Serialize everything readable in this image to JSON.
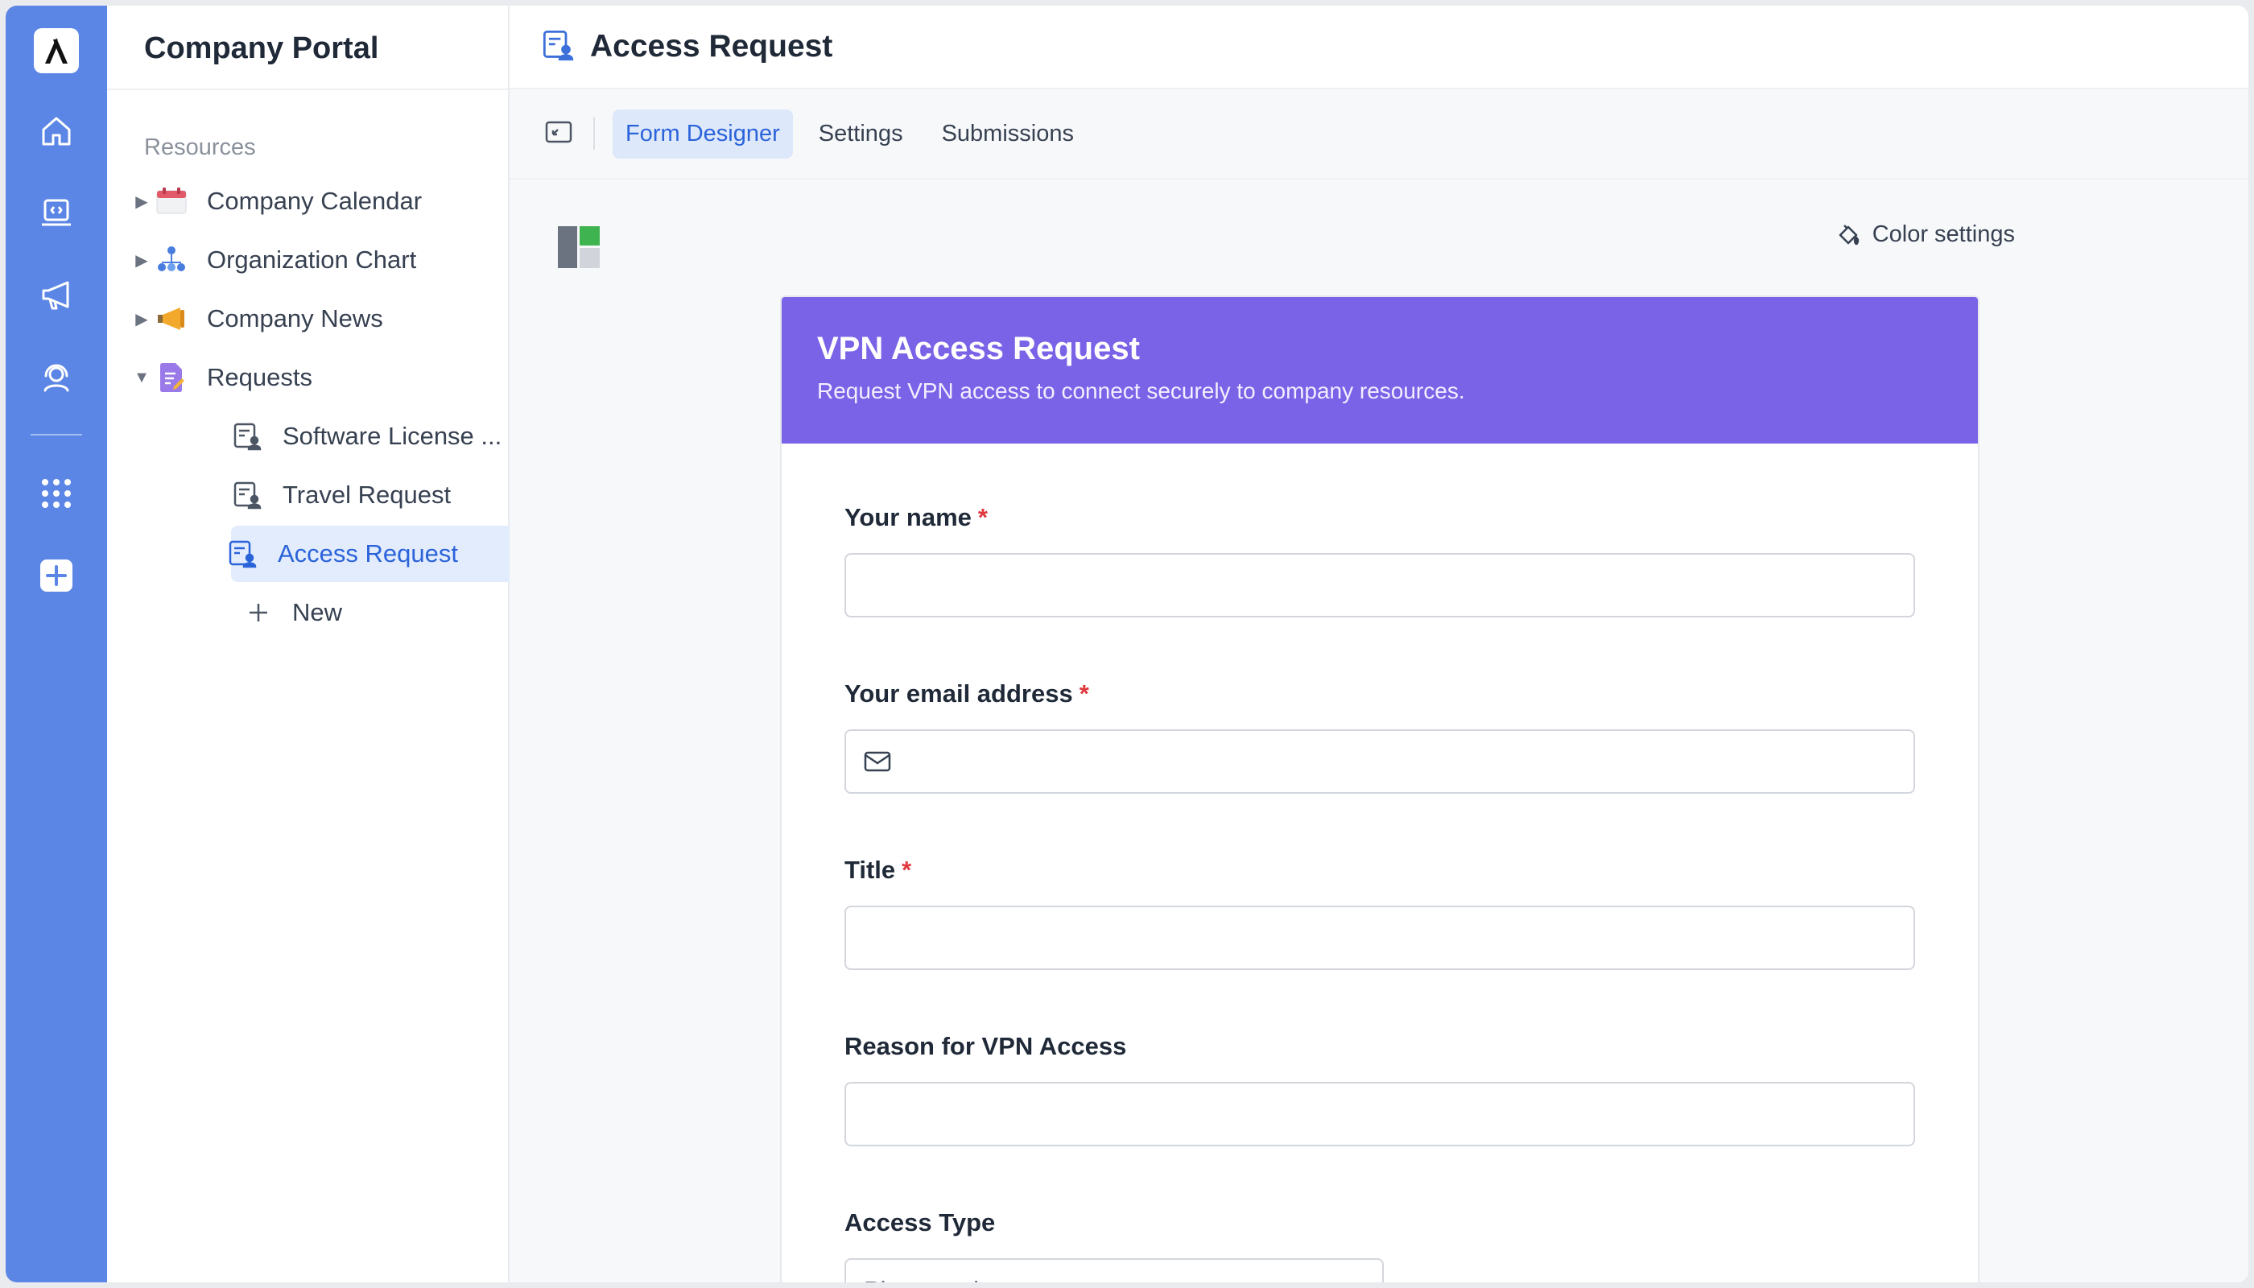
{
  "sidebar": {
    "title": "Company Portal",
    "section": "Resources",
    "items": [
      {
        "label": "Company Calendar"
      },
      {
        "label": "Organization Chart"
      },
      {
        "label": "Company News"
      },
      {
        "label": "Requests"
      },
      {
        "label": "Software License ..."
      },
      {
        "label": "Travel Request"
      },
      {
        "label": "Access Request"
      },
      {
        "label": "New"
      }
    ]
  },
  "header": {
    "title": "Access Request"
  },
  "tabs": [
    {
      "label": "Form Designer"
    },
    {
      "label": "Settings"
    },
    {
      "label": "Submissions"
    }
  ],
  "toolbar": {
    "color_settings": "Color settings"
  },
  "form": {
    "title": "VPN Access Request",
    "description": "Request VPN access to connect securely to company resources.",
    "header_color": "#7b63e8",
    "fields": [
      {
        "label": "Your name",
        "required": "*"
      },
      {
        "label": "Your email address",
        "required": "*"
      },
      {
        "label": "Title",
        "required": "*"
      },
      {
        "label": "Reason for VPN Access"
      },
      {
        "label": "Access Type",
        "placeholder": "Please select"
      }
    ]
  },
  "colors": {
    "rail": "#5b86e5",
    "accent": "#2b63d9",
    "required": "#e0383e"
  }
}
